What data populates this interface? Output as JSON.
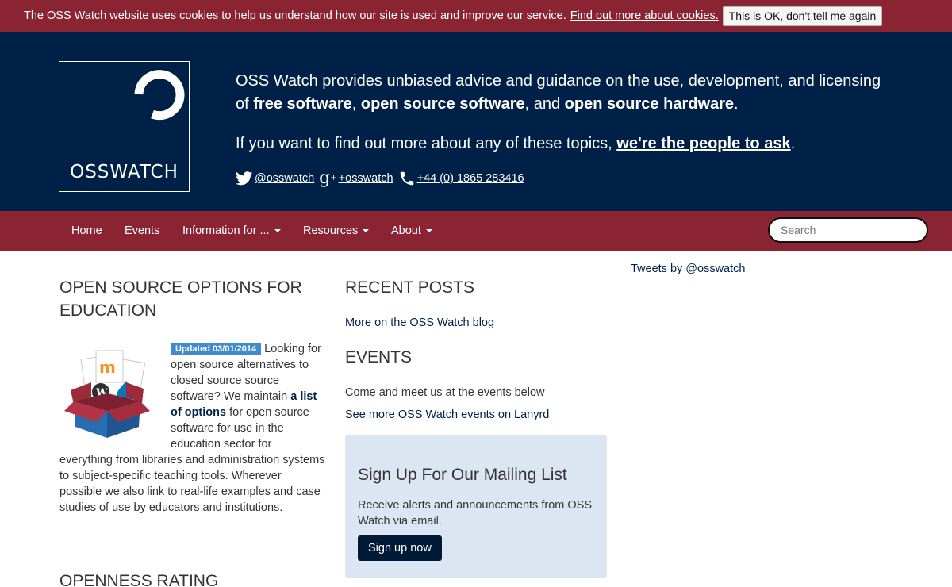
{
  "cookie_bar": {
    "message": "The OSS Watch website uses cookies to help us understand how our site is used and improve our service.",
    "link_label": "Find out more about cookies.",
    "button_label": "This is OK, don't tell me again"
  },
  "header": {
    "logo_text": "OSSWATCH",
    "intro_pre": "OSS Watch provides unbiased advice and guidance on the use, development, and licensing of ",
    "bold_1": "free software",
    "sep_1": ", ",
    "bold_2": "open source software",
    "sep_2": ", and ",
    "bold_3": "open source hardware",
    "end": ".",
    "ask_pre": "If you want to find out more about any of these topics, ",
    "ask_link": "we're the people to ask",
    "ask_end": ".",
    "social": {
      "twitter": "@osswatch",
      "gplus": "+osswatch",
      "phone": "+44 (0) 1865 283416"
    }
  },
  "nav": {
    "items": [
      "Home",
      "Events",
      "Information for ...",
      "Resources",
      "About"
    ],
    "search_placeholder": "Search"
  },
  "options": {
    "title": "OPEN SOURCE OPTIONS FOR EDUCATION",
    "badge": "Updated 03/01/2014",
    "text_1": " Looking for open source alternatives to closed source source software? We maintain ",
    "link": "a list of options",
    "text_2": " for open source software for use in the education sector for everything from libraries and administration systems to subject-specific teaching tools. Wherever possible we also link to real-life examples and case studies of use by educators and institutions."
  },
  "openness": {
    "title": "OPENNESS RATING"
  },
  "recent": {
    "title": "RECENT POSTS",
    "blog_link": "More on the OSS Watch blog"
  },
  "events": {
    "title": "EVENTS",
    "text": "Come and meet us at the events below",
    "lanyrd_link": "See more OSS Watch events on Lanyrd"
  },
  "mailing": {
    "title": "Sign Up For Our Mailing List",
    "text": "Receive alerts and announcements from OSS Watch via email.",
    "button": "Sign up now"
  },
  "tweets": {
    "label": "Tweets by @osswatch"
  },
  "colors": {
    "brand_red": "#8a2432",
    "brand_navy": "#002147",
    "badge_blue": "#428bca",
    "panel_blue": "#dce6f2"
  }
}
